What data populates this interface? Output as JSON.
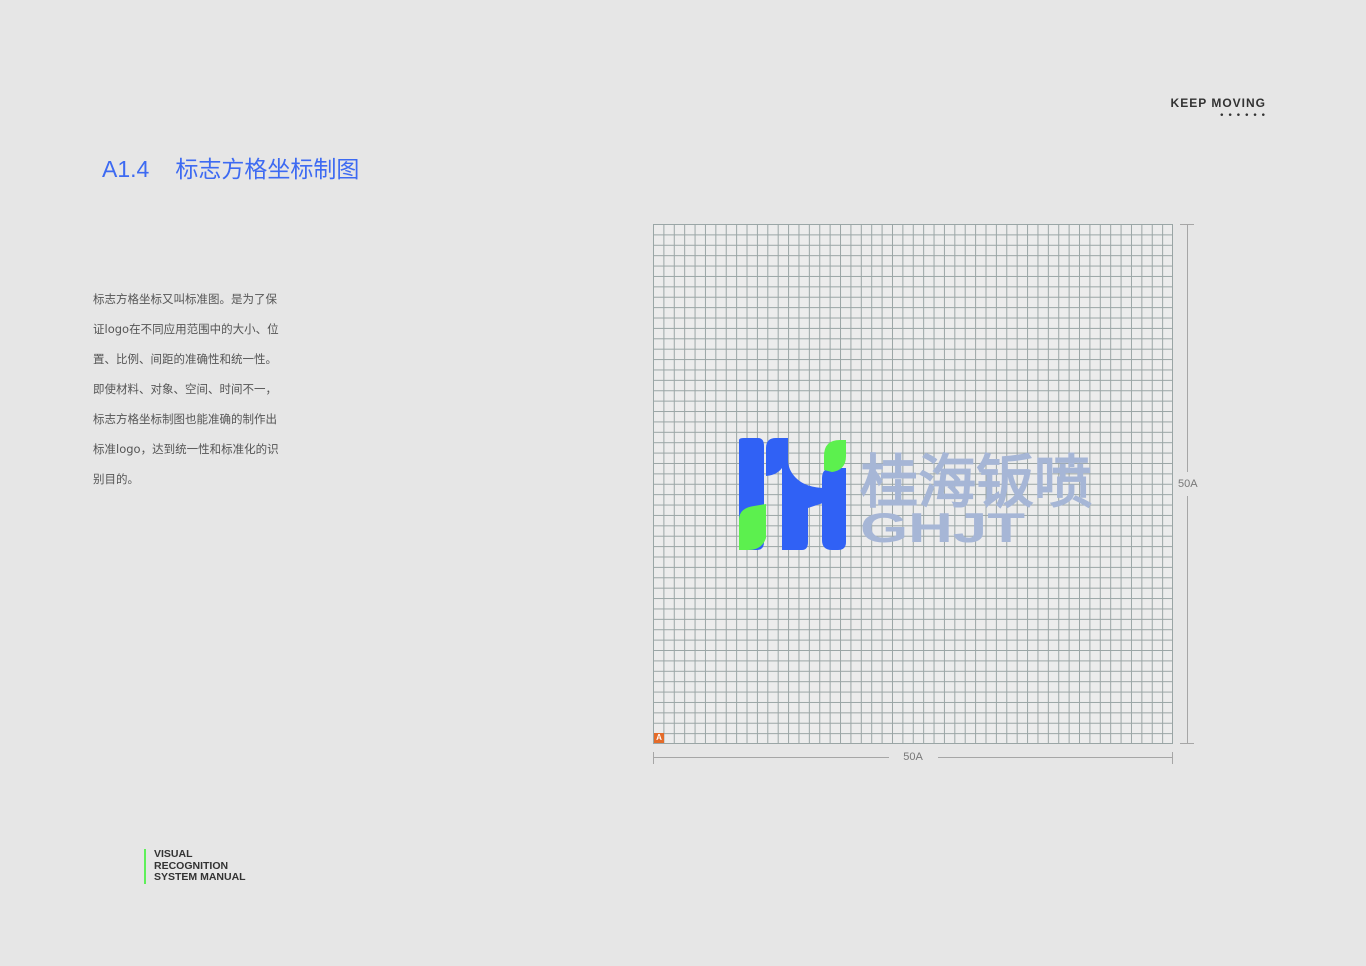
{
  "header": {
    "tagline": "KEEP MOVING",
    "dots": "••••••"
  },
  "section": {
    "code": "A1.4",
    "title": "标志方格坐标制图"
  },
  "description": [
    "标志方格坐标又叫标准图。是为了保",
    "证logo在不同应用范围中的大小、位",
    "置、比例、间距的准确性和统一性。",
    "即使材料、对象、空间、时间不一，",
    "标志方格坐标制图也能准确的制作出",
    "标准logo，达到统一性和标准化的识",
    "别目的。"
  ],
  "grid": {
    "unit_label": "A",
    "width_label": "50A",
    "height_label": "50A",
    "unit_color": "#e46b2a"
  },
  "logo": {
    "name_cn": "桂海钣喷",
    "name_en": "GHJT",
    "colors": {
      "blue": "#3061f5",
      "green": "#5cf04e",
      "text": "#a6b6d6"
    }
  },
  "footer": {
    "line1": "VISUAL",
    "line2": "RECOGNITION",
    "line3": "SYSTEM MANUAL"
  }
}
